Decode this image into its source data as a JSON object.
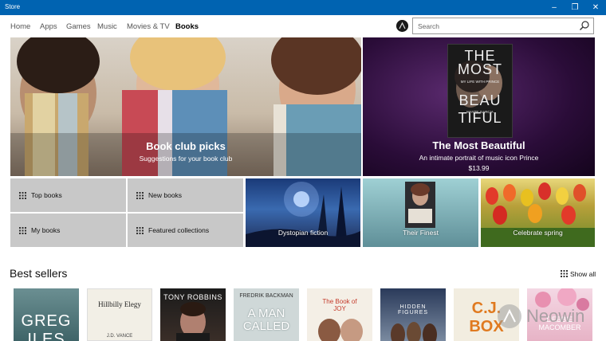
{
  "window": {
    "title": "Store"
  },
  "window_controls": {
    "minimize": "–",
    "maximize": "❐",
    "close": "✕"
  },
  "nav": {
    "tabs": [
      {
        "label": "Home"
      },
      {
        "label": "Apps"
      },
      {
        "label": "Games"
      },
      {
        "label": "Music"
      },
      {
        "label": "Movies & TV"
      },
      {
        "label": "Books"
      }
    ],
    "active_tab": "Books"
  },
  "search": {
    "placeholder": "Search"
  },
  "hero": [
    {
      "title": "Book club picks",
      "subtitle": "Suggestions for your book club"
    },
    {
      "title": "The Most Beautiful",
      "subtitle": "An intimate portrait of music icon Prince",
      "price": "$13.99",
      "cover_text": [
        "THE",
        "MOST",
        "BEAU",
        "TIFUL"
      ],
      "cover_line": "MY LIFE WITH PRINCE",
      "cover_author": "MAYTE GARCIA"
    }
  ],
  "quick_links": [
    {
      "label": "Top books"
    },
    {
      "label": "New books"
    },
    {
      "label": "My books"
    },
    {
      "label": "Featured collections"
    }
  ],
  "collections": [
    {
      "label": "Dystopian fiction"
    },
    {
      "label": "Their Finest"
    },
    {
      "label": "Celebrate spring"
    }
  ],
  "best_sellers": {
    "title": "Best sellers",
    "show_all": "Show all",
    "books": [
      {
        "title": "GREG ILES"
      },
      {
        "title": "Hillbilly Elegy",
        "author": "J.D. VANCE"
      },
      {
        "title": "TONY ROBBINS"
      },
      {
        "title": "A MAN CALLED",
        "author": "FREDRIK BACKMAN"
      },
      {
        "title": "The Book of JOY"
      },
      {
        "title": "HIDDEN FIGURES"
      },
      {
        "title": "C.J. BOX"
      },
      {
        "title": "DEBBIE MACOMBER"
      }
    ]
  },
  "watermark": "Neowin",
  "colors": {
    "titlebar": "#0063b1",
    "tile_gray": "#c8c8c8"
  }
}
